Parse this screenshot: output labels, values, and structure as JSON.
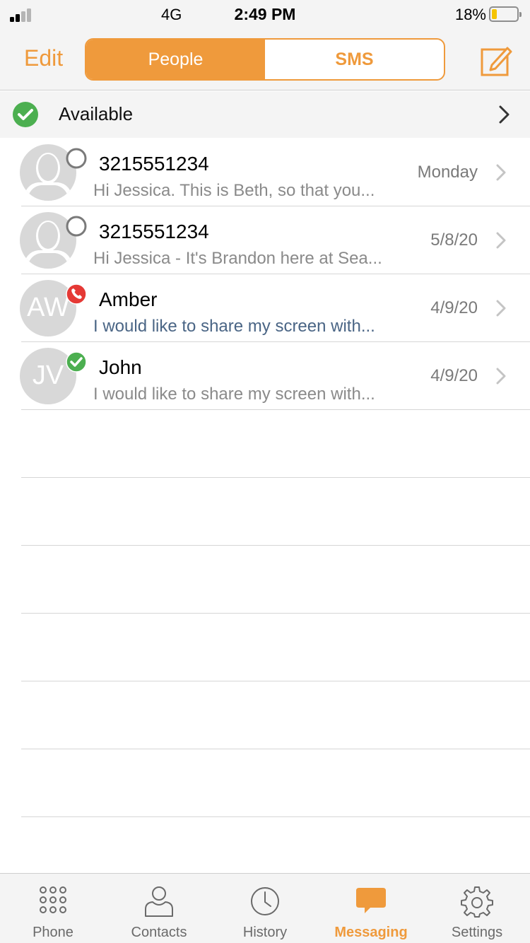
{
  "status_bar": {
    "network": "4G",
    "time": "2:49 PM",
    "battery_percent": "18%",
    "battery_level": 0.18,
    "signal_bars_filled": 2,
    "signal_bars_total": 4
  },
  "nav": {
    "edit_label": "Edit",
    "segments": [
      {
        "label": "People",
        "active": true
      },
      {
        "label": "SMS",
        "active": false
      }
    ],
    "compose_icon": "compose-icon"
  },
  "availability": {
    "label": "Available",
    "icon": "check-circle-icon",
    "color": "#4caf50"
  },
  "messages": [
    {
      "name": "3215551234",
      "preview": "Hi Jessica. This is Beth, so that you...",
      "date": "Monday",
      "avatar_initials": "",
      "presence": "offline",
      "unread": false
    },
    {
      "name": "3215551234",
      "preview": "Hi Jessica - It's Brandon here at Sea...",
      "date": "5/8/20",
      "avatar_initials": "",
      "presence": "offline",
      "unread": false
    },
    {
      "name": "Amber",
      "preview": "I would like to share my screen with...",
      "date": "4/9/20",
      "avatar_initials": "AW",
      "presence": "on-call",
      "unread": true
    },
    {
      "name": "John",
      "preview": "I would like to share my screen with...",
      "date": "4/9/20",
      "avatar_initials": "JV",
      "presence": "available",
      "unread": false
    }
  ],
  "tabs": [
    {
      "label": "Phone",
      "icon": "dialpad-icon",
      "active": false
    },
    {
      "label": "Contacts",
      "icon": "contacts-icon",
      "active": false
    },
    {
      "label": "History",
      "icon": "clock-icon",
      "active": false
    },
    {
      "label": "Messaging",
      "icon": "chat-bubble-icon",
      "active": true
    },
    {
      "label": "Settings",
      "icon": "gear-icon",
      "active": false
    }
  ],
  "colors": {
    "accent": "#ef9a3c",
    "available": "#4caf50",
    "busy": "#e53935",
    "offline_ring": "#7a7a7a"
  }
}
